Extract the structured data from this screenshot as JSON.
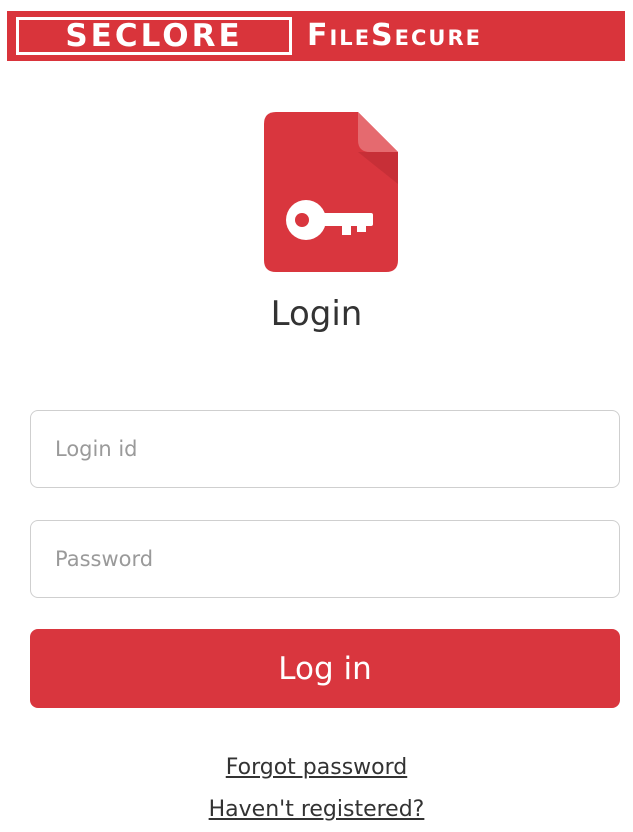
{
  "brand": {
    "company": "SECLORE",
    "product": "FileSecure",
    "color": "#d9343b"
  },
  "logo": {
    "icon": "document-key-icon",
    "color": "#d9363e"
  },
  "title": "Login",
  "form": {
    "login_id": {
      "value": "",
      "placeholder": "Login id"
    },
    "password": {
      "value": "",
      "placeholder": "Password"
    },
    "submit_label": "Log in"
  },
  "links": {
    "forgot_password": "Forgot password",
    "register": "Haven't registered?"
  }
}
